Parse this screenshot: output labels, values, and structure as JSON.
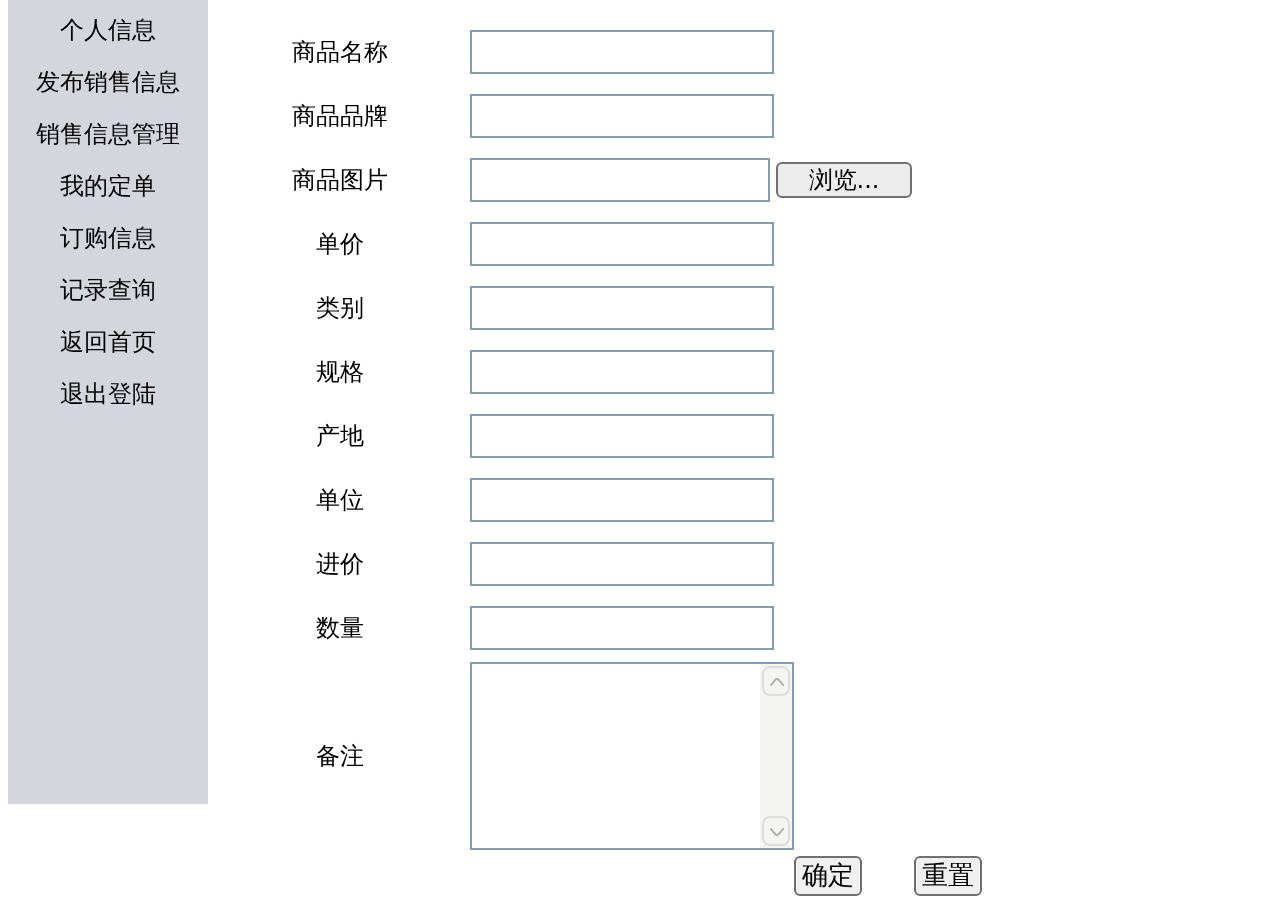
{
  "sidebar": {
    "items": [
      "个人信息",
      "发布销售信息",
      "销售信息管理",
      "我的定单",
      "订购信息",
      "记录查询",
      "返回首页",
      "退出登陆"
    ]
  },
  "form": {
    "fields": [
      {
        "label": "商品名称",
        "kind": "text"
      },
      {
        "label": "商品品牌",
        "kind": "text"
      },
      {
        "label": "商品图片",
        "kind": "file",
        "button": "浏览..."
      },
      {
        "label": "单价",
        "kind": "text"
      },
      {
        "label": "类别",
        "kind": "text"
      },
      {
        "label": "规格",
        "kind": "text"
      },
      {
        "label": "产地",
        "kind": "text"
      },
      {
        "label": "单位",
        "kind": "text"
      },
      {
        "label": "进价",
        "kind": "text"
      },
      {
        "label": "数量",
        "kind": "text"
      },
      {
        "label": "备注",
        "kind": "textarea"
      }
    ],
    "buttons": [
      "确定",
      "重置"
    ]
  }
}
